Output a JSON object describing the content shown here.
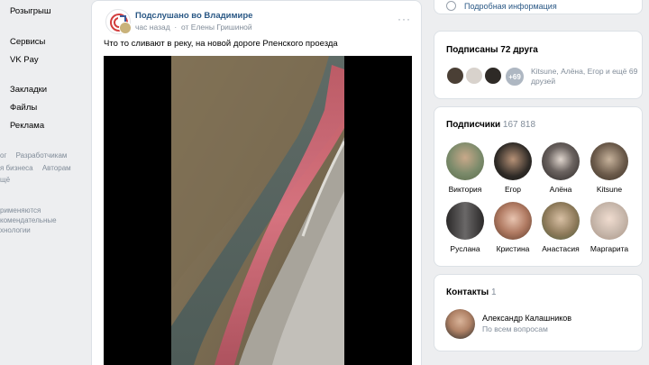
{
  "sidebar": {
    "items": [
      {
        "label": "Розыгрыш"
      },
      {
        "label": "Сервисы"
      },
      {
        "label": "VK Pay"
      },
      {
        "label": "Закладки"
      },
      {
        "label": "Файлы"
      },
      {
        "label": "Реклама"
      }
    ],
    "footer_row1": [
      "ог",
      "Разработчикам"
    ],
    "footer_row2": [
      "я бизнеса",
      "Авторам"
    ],
    "footer_row3": "щё",
    "footer_note": [
      "рименяются",
      "комендательные",
      "хнологии"
    ]
  },
  "post": {
    "group_name": "Подслушано во Владимире",
    "time": "час назад",
    "author": "от Елены Гришиной",
    "text": "Что то сливают в реку, на новой дороге Рпенского проезда",
    "more_label": "···"
  },
  "right": {
    "info_link": "Подробная информация",
    "friends": {
      "title": "Подписаны 72 друга",
      "more_badge": "+69",
      "names": "Kitsune, Алёна, Егор и ещё 69 друзей"
    },
    "subscribers": {
      "title": "Подписчики",
      "count": "167 818",
      "people": [
        {
          "name": "Виктория",
          "color": "#7a8a6a"
        },
        {
          "name": "Егор",
          "color": "#2e2a26"
        },
        {
          "name": "Алёна",
          "color": "#3b3634"
        },
        {
          "name": "Kitsune",
          "color": "#6b5a4a"
        },
        {
          "name": "Руслана",
          "color": "#4a4848"
        },
        {
          "name": "Кристина",
          "color": "#b07a62"
        },
        {
          "name": "Анастасия",
          "color": "#8e7a5a"
        },
        {
          "name": "Маргарита",
          "color": "#c9b9ad"
        }
      ]
    },
    "contacts": {
      "title": "Контакты",
      "count": "1",
      "name": "Александр Калашников",
      "role": "По всем вопросам"
    }
  },
  "colors": {
    "link": "#2a5885",
    "muted": "#818c99",
    "bg": "#edeef0",
    "water_pink": "#e0707c"
  }
}
